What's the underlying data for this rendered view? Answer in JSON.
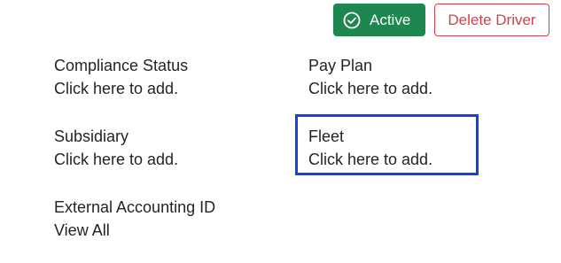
{
  "header": {
    "status_label": "Active",
    "status_icon": "check-circle-icon",
    "status_color": "#1e874f",
    "delete_label": "Delete Driver",
    "delete_color": "#d6404a"
  },
  "fields": {
    "compliance_status": {
      "label": "Compliance Status",
      "value": "Click here to add."
    },
    "pay_plan": {
      "label": "Pay Plan",
      "value": "Click here to add."
    },
    "subsidiary": {
      "label": "Subsidiary",
      "value": "Click here to add."
    },
    "fleet": {
      "label": "Fleet",
      "value": "Click here to add.",
      "focus_color": "#1446d6"
    },
    "external_accounting_id": {
      "label": "External Accounting ID",
      "value": "View All"
    }
  }
}
